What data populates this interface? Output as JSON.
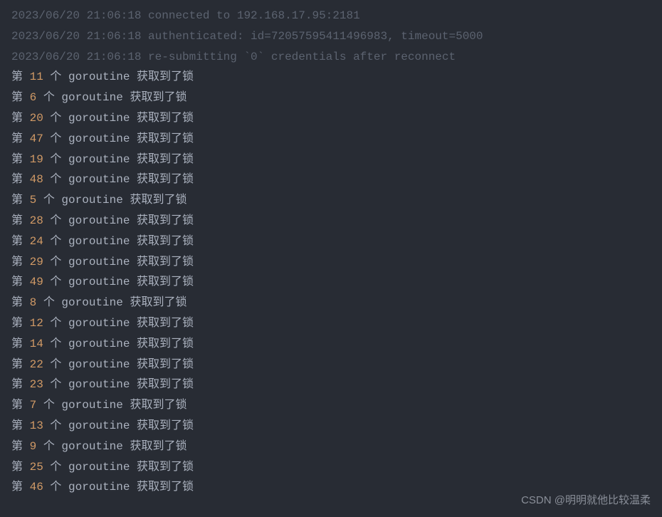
{
  "log_lines": [
    "2023/06/20 21:06:18 connected to 192.168.17.95:2181",
    "2023/06/20 21:06:18 authenticated: id=72057595411496983, timeout=5000",
    "2023/06/20 21:06:18 re-submitting `0` credentials after reconnect"
  ],
  "goroutine_template": {
    "prefix": "第 ",
    "mid": " 个 goroutine ",
    "suffix": "获取到了锁"
  },
  "goroutine_ids": [
    11,
    6,
    20,
    47,
    19,
    48,
    5,
    28,
    24,
    29,
    49,
    8,
    12,
    14,
    22,
    23,
    7,
    13,
    9,
    25,
    46
  ],
  "watermark": "CSDN @明明就他比较温柔"
}
